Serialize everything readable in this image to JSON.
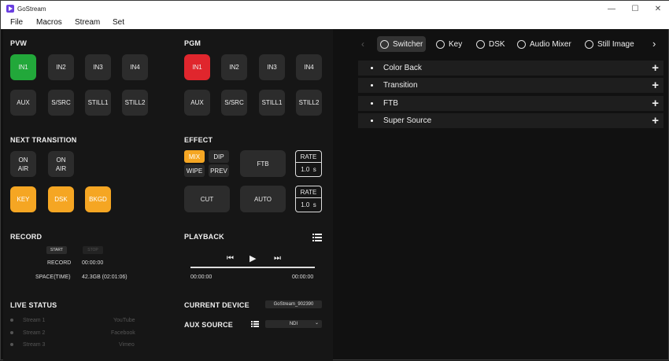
{
  "app": {
    "title": "GoStream"
  },
  "menu": [
    "File",
    "Macros",
    "Stream",
    "Set"
  ],
  "pvw": {
    "title": "PVW",
    "buttons": [
      "IN1",
      "IN2",
      "IN3",
      "IN4",
      "AUX",
      "S/SRC",
      "STILL1",
      "STILL2"
    ]
  },
  "pgm": {
    "title": "PGM",
    "buttons": [
      "IN1",
      "IN2",
      "IN3",
      "IN4",
      "AUX",
      "S/SRC",
      "STILL1",
      "STILL2"
    ]
  },
  "next_transition": {
    "title": "NEXT TRANSITION",
    "on_air1": "ON\nAIR",
    "on_air2": "ON\nAIR",
    "keys": [
      "KEY",
      "DSK",
      "BKGD"
    ]
  },
  "effect": {
    "title": "EFFECT",
    "types": [
      "MIX",
      "DIP",
      "WIPE",
      "PREV"
    ],
    "ftb": "FTB",
    "cut": "CUT",
    "auto": "AUTO",
    "rate1": {
      "label": "RATE",
      "value": "1.0",
      "unit": "s"
    },
    "rate2": {
      "label": "RATE",
      "value": "1.0",
      "unit": "s"
    }
  },
  "record": {
    "title": "RECORD",
    "start": "START",
    "stop": "STOP",
    "record_label": "RECORD",
    "record_time": "00:00:00",
    "space_label": "SPACE(TIME)",
    "space_value": "42.3GB (02:01:06)"
  },
  "playback": {
    "title": "PLAYBACK",
    "time_start": "00:00:00",
    "time_end": "00:00:00"
  },
  "live_status": {
    "title": "LIVE STATUS",
    "streams": [
      {
        "name": "Stream 1",
        "platform": "YouTube"
      },
      {
        "name": "Stream 2",
        "platform": "Facebook"
      },
      {
        "name": "Stream 3",
        "platform": "Vimeo"
      }
    ]
  },
  "current_device": {
    "label": "CURRENT DEVICE",
    "value": "GoStream_902390"
  },
  "aux_source": {
    "label": "AUX SOURCE",
    "value": "NDI"
  },
  "tabs": [
    "Switcher",
    "Key",
    "DSK",
    "Audio Mixer",
    "Still Image"
  ],
  "sections": [
    "Color Back",
    "Transition",
    "FTB",
    "Super Source"
  ],
  "colors": {
    "green": "#22a83a",
    "red": "#e0262d",
    "orange": "#f5a623"
  }
}
